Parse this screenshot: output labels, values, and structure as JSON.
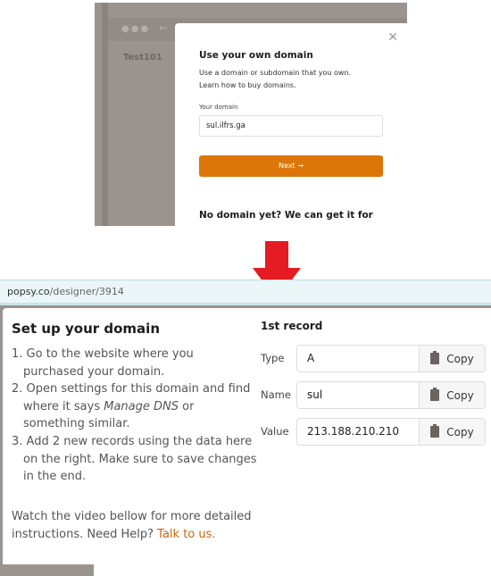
{
  "top_screenshot": {
    "sidebar_project": "Test101",
    "modal": {
      "title": "Use your own domain",
      "description_line1": "Use a domain or subdomain that you own.",
      "description_line2": "Learn how to buy domains.",
      "domain_label": "Your domain",
      "domain_value": "sul.ilfrs.ga",
      "next_label": "Next →",
      "no_domain_heading": "No domain yet? We can get it for"
    }
  },
  "arrow_color": "#e41b23",
  "bottom_screenshot": {
    "url_host": "popsy.co",
    "url_path": "/designer/3914",
    "title": "Set up your domain",
    "steps": [
      {
        "num": "1.",
        "text": "Go to the website where you purchased your domain."
      },
      {
        "num": "2.",
        "pre": "Open settings for this domain and find where it says ",
        "em": "Manage DNS",
        "post": " or something similar."
      },
      {
        "num": "3.",
        "text": "Add 2 new records using the data here on the right. Make sure to save changes in the end."
      }
    ],
    "help_text": "Watch the video bellow for more detailed instructions. Need Help? ",
    "help_link": "Talk to us.",
    "record_title": "1st record",
    "records": [
      {
        "label": "Type",
        "value": "A",
        "copy": "Copy"
      },
      {
        "label": "Name",
        "value": "sul",
        "copy": "Copy"
      },
      {
        "label": "Value",
        "value": "213.188.210.210",
        "copy": "Copy"
      }
    ],
    "accent_color": "#dc7608"
  }
}
